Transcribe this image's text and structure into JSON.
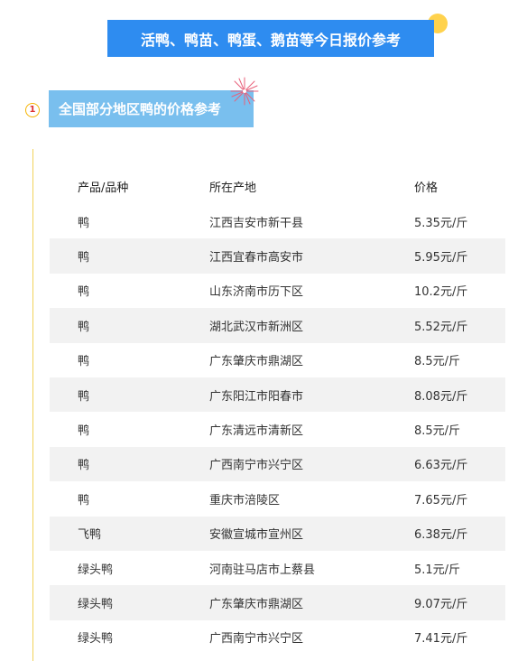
{
  "title": "活鸭、鸭苗、鸭蛋、鹅苗等今日报价参考",
  "section": {
    "number": "1",
    "heading": "全国部分地区鸭的价格参考"
  },
  "table": {
    "headers": [
      "产品/品种",
      "所在产地",
      "价格"
    ],
    "rows": [
      [
        "鸭",
        "江西吉安市新干县",
        "5.35元/斤"
      ],
      [
        "鸭",
        "江西宜春市高安市",
        "5.95元/斤"
      ],
      [
        "鸭",
        "山东济南市历下区",
        "10.2元/斤"
      ],
      [
        "鸭",
        "湖北武汉市新洲区",
        "5.52元/斤"
      ],
      [
        "鸭",
        "广东肇庆市鼎湖区",
        "8.5元/斤"
      ],
      [
        "鸭",
        "广东阳江市阳春市",
        "8.08元/斤"
      ],
      [
        "鸭",
        "广东清远市清新区",
        "8.5元/斤"
      ],
      [
        "鸭",
        "广西南宁市兴宁区",
        "6.63元/斤"
      ],
      [
        "鸭",
        "重庆市涪陵区",
        "7.65元/斤"
      ],
      [
        "飞鸭",
        "安徽宣城市宣州区",
        "6.38元/斤"
      ],
      [
        "绿头鸭",
        "河南驻马店市上蔡县",
        "5.1元/斤"
      ],
      [
        "绿头鸭",
        "广东肇庆市鼎湖区",
        "9.07元/斤"
      ],
      [
        "绿头鸭",
        "广西南宁市兴宁区",
        "7.41元/斤"
      ]
    ]
  },
  "colors": {
    "title_banner": "#2e8cf0",
    "section_banner": "#79bfee",
    "accent_yellow": "#ffd24d",
    "row_stripe": "#f2f2f2"
  }
}
